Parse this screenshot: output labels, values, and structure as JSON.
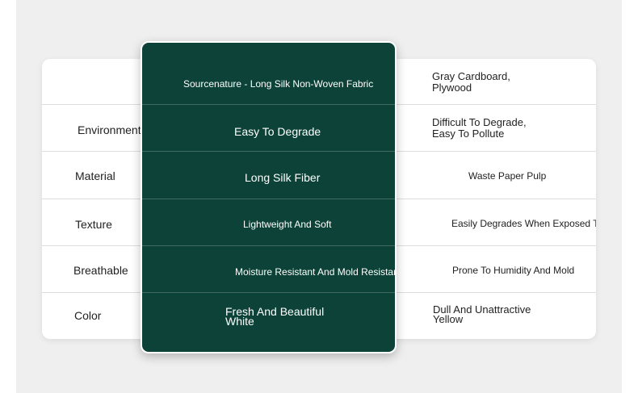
{
  "rows": [
    {
      "label": "",
      "ours": "Sourcenature - Long Silk Non-Woven Fabric",
      "other": "Gray Cardboard, Plywood"
    },
    {
      "label": "Environmentally Friendly",
      "ours": "Easy To Degrade",
      "other": "Difficult To Degrade, Easy To Pollute"
    },
    {
      "label": "Material",
      "ours": "Long Silk Fiber",
      "other": "Waste Paper Pulp"
    },
    {
      "label": "Texture",
      "ours": "Lightweight And Soft",
      "other": "Easily Degrades When Exposed To Water"
    },
    {
      "label": "Breathable",
      "ours": "Moisture Resistant And Mold Resistant",
      "other": "Prone To Humidity And Mold"
    },
    {
      "label": "Color",
      "ours": "Fresh And Beautiful White",
      "other": "Dull And Unattractive Yellow"
    }
  ],
  "colors": {
    "panel": "#0c4237",
    "background": "#efefef"
  }
}
